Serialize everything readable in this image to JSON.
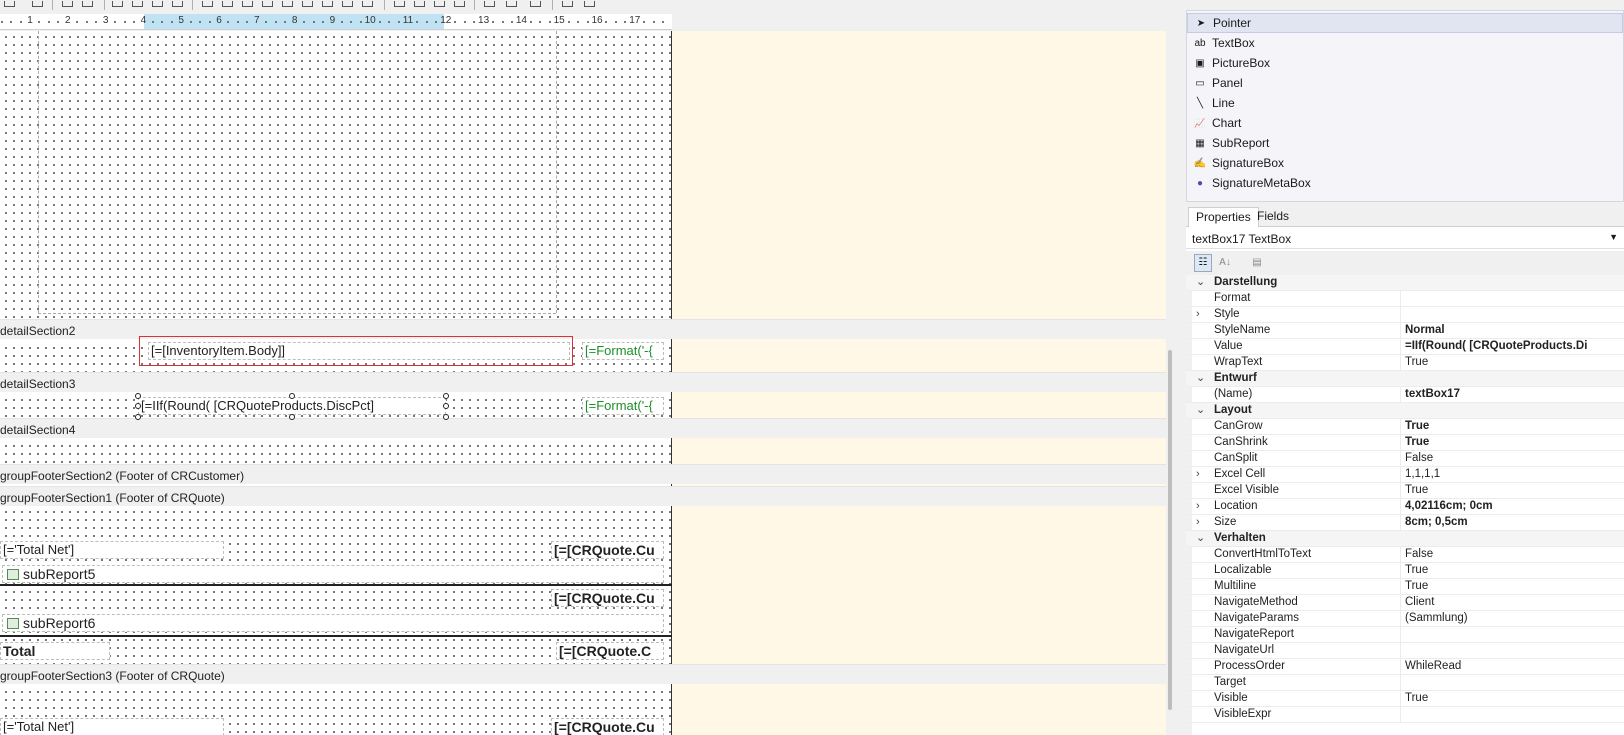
{
  "ruler": {
    "numbers": [
      "1",
      "2",
      "3",
      "4",
      "5",
      "6",
      "7",
      "8",
      "9",
      "10",
      "11",
      "12",
      "13",
      "14",
      "15",
      "16",
      "17"
    ]
  },
  "sections": {
    "detail2": "detailSection2",
    "detail3": "detailSection3",
    "detail4": "detailSection4",
    "gf2": "groupFooterSection2 (Footer of CRCustomer)",
    "gf1": "groupFooterSection1 (Footer of CRQuote)",
    "gf3": "groupFooterSection3 (Footer of CRQuote)"
  },
  "fields": {
    "inventory_body": "[=[InventoryItem.Body]]",
    "format_a": "[=Format('-{",
    "iif_disc": "[=IIf(Round( [CRQuoteProducts.DiscPct]",
    "format_b": "[=Format('-{",
    "total_net_1": "[='Total Net']",
    "crquote_1": "[=[CRQuote.Cu",
    "subreport5": "subReport5",
    "crquote_2": "[=[CRQuote.Cu",
    "subreport6": "subReport6",
    "total": "Total",
    "crquote_3": "[=[CRQuote.C",
    "total_net_2": "[='Total Net']",
    "crquote_4": "[=[CRQuote.Cu"
  },
  "toolbox": {
    "items": [
      {
        "label": "Pointer",
        "icon": "pointer-icon"
      },
      {
        "label": "TextBox",
        "icon": "textbox-icon"
      },
      {
        "label": "PictureBox",
        "icon": "picturebox-icon"
      },
      {
        "label": "Panel",
        "icon": "panel-icon"
      },
      {
        "label": "Line",
        "icon": "line-icon"
      },
      {
        "label": "Chart",
        "icon": "chart-icon"
      },
      {
        "label": "SubReport",
        "icon": "subreport-icon"
      },
      {
        "label": "SignatureBox",
        "icon": "signature-icon"
      },
      {
        "label": "SignatureMetaBox",
        "icon": "person-icon"
      }
    ],
    "selected": "Pointer"
  },
  "properties": {
    "tabs": [
      "Properties",
      "Fields"
    ],
    "active_tab": "Properties",
    "object": "textBox17 TextBox",
    "rows": [
      {
        "type": "cat",
        "name": "Darstellung"
      },
      {
        "name": "Format",
        "value": ""
      },
      {
        "name": "Style",
        "value": "",
        "expand": true
      },
      {
        "name": "StyleName",
        "value": "Normal",
        "bold": true
      },
      {
        "name": "Value",
        "value": "=IIf(Round( [CRQuoteProducts.Di",
        "bold": true
      },
      {
        "name": "WrapText",
        "value": "True"
      },
      {
        "type": "cat",
        "name": "Entwurf"
      },
      {
        "name": "(Name)",
        "value": "textBox17",
        "bold": true
      },
      {
        "type": "cat",
        "name": "Layout"
      },
      {
        "name": "CanGrow",
        "value": "True",
        "bold": true
      },
      {
        "name": "CanShrink",
        "value": "True",
        "bold": true
      },
      {
        "name": "CanSplit",
        "value": "False"
      },
      {
        "name": "Excel Cell",
        "value": "1,1,1,1",
        "expand": true
      },
      {
        "name": "Excel Visible",
        "value": "True"
      },
      {
        "name": "Location",
        "value": "4,02116cm; 0cm",
        "bold": true,
        "expand": true
      },
      {
        "name": "Size",
        "value": "8cm; 0,5cm",
        "bold": true,
        "expand": true
      },
      {
        "type": "cat",
        "name": "Verhalten"
      },
      {
        "name": "ConvertHtmlToText",
        "value": "False"
      },
      {
        "name": "Localizable",
        "value": "True"
      },
      {
        "name": "Multiline",
        "value": "True"
      },
      {
        "name": "NavigateMethod",
        "value": "Client"
      },
      {
        "name": "NavigateParams",
        "value": "(Sammlung)"
      },
      {
        "name": "NavigateReport",
        "value": ""
      },
      {
        "name": "NavigateUrl",
        "value": ""
      },
      {
        "name": "ProcessOrder",
        "value": "WhileRead"
      },
      {
        "name": "Target",
        "value": ""
      },
      {
        "name": "Visible",
        "value": "True"
      },
      {
        "name": "VisibleExpr",
        "value": ""
      }
    ]
  }
}
